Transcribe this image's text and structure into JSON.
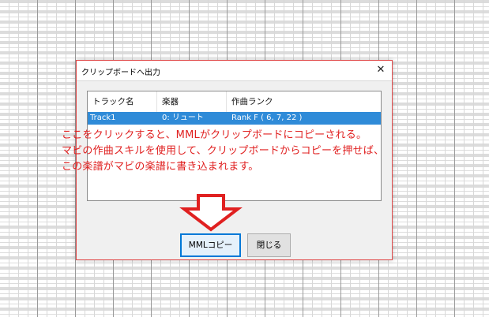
{
  "dialog": {
    "title": "クリップボードへ出力",
    "close_glyph": "✕"
  },
  "list": {
    "columns": [
      "トラック名",
      "楽器",
      "作曲ランク"
    ],
    "rows": [
      {
        "track": "Track1",
        "instrument": "0: リュート",
        "rank": "Rank F ( 6, 7, 22 )",
        "selected": true
      }
    ]
  },
  "buttons": {
    "mml_copy": "MMLコピー",
    "close": "閉じる"
  },
  "annotation": {
    "lines": [
      "ここをクリックすると、MMLがクリップボードにコピーされる。",
      "マビの作曲スキルを使用して、クリップボードからコピーを押せば、",
      "この楽譜がマビの楽譜に書き込まれます。"
    ],
    "color": "#e02020"
  },
  "colors": {
    "selection": "#2f8bd8",
    "dialog_border": "#e04a4a",
    "focus_border": "#0078d7"
  }
}
